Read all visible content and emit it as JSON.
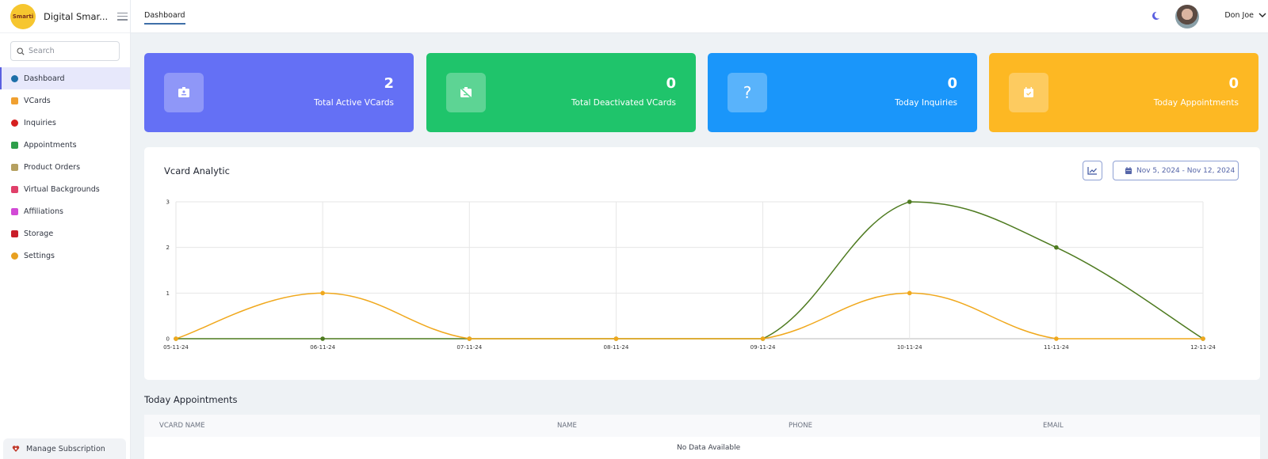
{
  "brand": {
    "logo_text": "Smarti",
    "name": "Digital Smar..."
  },
  "search": {
    "placeholder": "Search",
    "value": ""
  },
  "sidebar": {
    "items": [
      {
        "label": "Dashboard",
        "icon": "dashboard-icon",
        "color": "#1e6fa8",
        "active": true
      },
      {
        "label": "VCards",
        "icon": "vcard-icon",
        "color": "#f0a030"
      },
      {
        "label": "Inquiries",
        "icon": "inquiry-icon",
        "color": "#d61f1f"
      },
      {
        "label": "Appointments",
        "icon": "calendar-icon",
        "color": "#2e9e4a"
      },
      {
        "label": "Product Orders",
        "icon": "orders-icon",
        "color": "#b5a060"
      },
      {
        "label": "Virtual Backgrounds",
        "icon": "background-icon",
        "color": "#e0406a"
      },
      {
        "label": "Affiliations",
        "icon": "affiliation-icon",
        "color": "#d24ad6"
      },
      {
        "label": "Storage",
        "icon": "storage-icon",
        "color": "#c81e2a"
      },
      {
        "label": "Settings",
        "icon": "gear-icon",
        "color": "#e8a020"
      }
    ],
    "manage_subscription": "Manage Subscription"
  },
  "topbar": {
    "tab": "Dashboard",
    "user_name": "Don Joe"
  },
  "cards": [
    {
      "value": "2",
      "label": "Total Active VCards",
      "color": "#6470f5",
      "icon": "id-badge-icon"
    },
    {
      "value": "0",
      "label": "Total Deactivated VCards",
      "color": "#1fc46b",
      "icon": "id-badge-slash-icon"
    },
    {
      "value": "0",
      "label": "Today Inquiries",
      "color": "#1a96fa",
      "icon": "question-icon"
    },
    {
      "value": "0",
      "label": "Today Appointments",
      "color": "#fdb823",
      "icon": "calendar-check-icon"
    }
  ],
  "analytic": {
    "title": "Vcard Analytic",
    "date_range": "Nov 5, 2024 - Nov 12, 2024"
  },
  "chart_data": {
    "type": "line",
    "title": "Vcard Analytic",
    "x": [
      "05-11-24",
      "06-11-24",
      "07-11-24",
      "08-11-24",
      "09-11-24",
      "10-11-24",
      "11-11-24",
      "12-11-24"
    ],
    "series": [
      {
        "name": "green-series",
        "color": "#4d7a1f",
        "values": [
          0,
          0,
          0,
          0,
          0,
          3,
          2,
          0
        ]
      },
      {
        "name": "orange-series",
        "color": "#f0a81c",
        "values": [
          0,
          1,
          0,
          0,
          0,
          1,
          0,
          0
        ]
      }
    ],
    "yticks": [
      0,
      1,
      2,
      3
    ],
    "ylim": [
      0,
      3
    ],
    "grid": true,
    "smooth": true
  },
  "appointments": {
    "title": "Today Appointments",
    "columns": [
      "VCARD NAME",
      "NAME",
      "PHONE",
      "EMAIL"
    ],
    "rows": [],
    "empty_text": "No Data Available"
  }
}
